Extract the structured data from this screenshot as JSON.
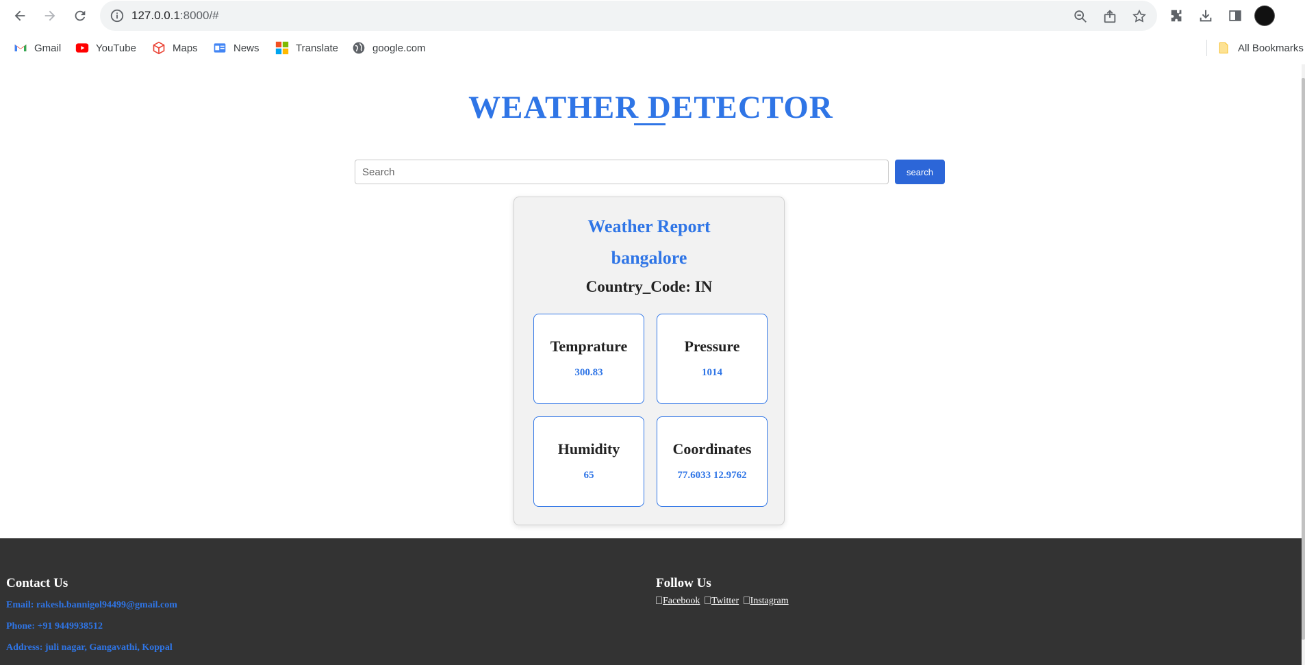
{
  "browser": {
    "url_host": "127.0.0.1",
    "url_rest": ":8000/#",
    "bookmarks": [
      {
        "label": "Gmail",
        "icon": "gmail-icon"
      },
      {
        "label": "YouTube",
        "icon": "youtube-icon"
      },
      {
        "label": "Maps",
        "icon": "maps-icon"
      },
      {
        "label": "News",
        "icon": "news-icon"
      },
      {
        "label": "Translate",
        "icon": "translate-icon"
      },
      {
        "label": "google.com",
        "icon": "globe-icon"
      }
    ],
    "all_bookmarks": "All Bookmarks"
  },
  "header": {
    "title": "WEATHER DETECTOR"
  },
  "search": {
    "placeholder": "Search",
    "button_label": "search"
  },
  "report": {
    "title": "Weather Report",
    "city": "bangalore",
    "country": "Country_Code: IN",
    "stats": [
      {
        "label": "Temprature",
        "value": "300.83"
      },
      {
        "label": "Pressure",
        "value": "1014"
      },
      {
        "label": "Humidity",
        "value": "65"
      },
      {
        "label": "Coordinates",
        "value": "77.6033 12.9762"
      }
    ]
  },
  "footer": {
    "contact_heading": "Contact Us",
    "email": "Email: rakesh.bannigol94499@gmail.com",
    "phone": "Phone: +91 9449938512",
    "address": "Address: juli nagar, Gangavathi, Koppal",
    "follow_heading": "Follow Us",
    "social": [
      "Facebook",
      "Twitter",
      "Instagram"
    ]
  },
  "colors": {
    "accent": "#2f75e6",
    "footer_bg": "#333333",
    "button_bg": "#2c66d8"
  }
}
